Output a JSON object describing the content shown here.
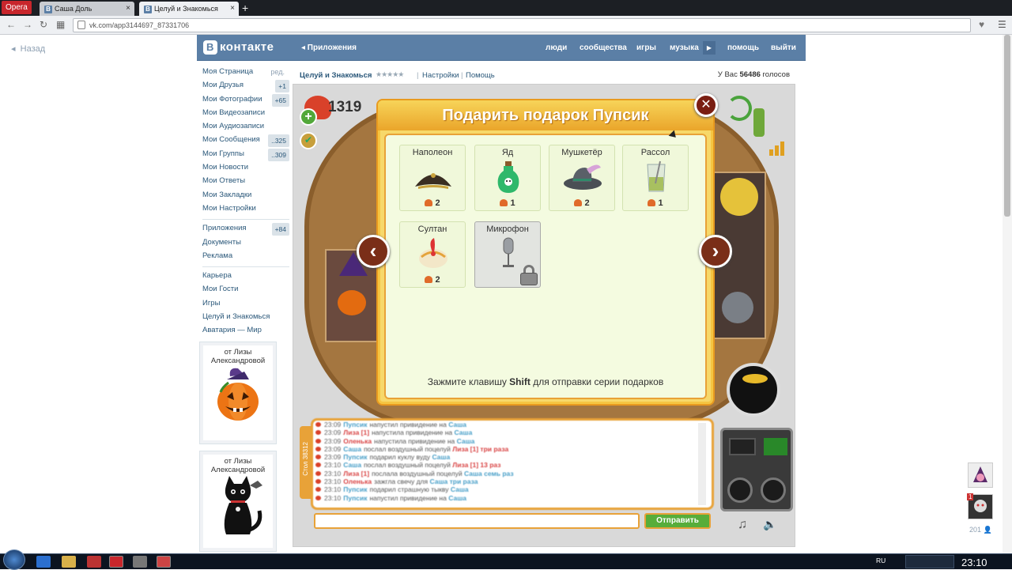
{
  "browser": {
    "menu_label": "Opera",
    "tabs": [
      {
        "label": "Саша Доль",
        "active": false
      },
      {
        "label": "Целуй и Знакомься",
        "active": true
      }
    ],
    "url": "vk.com/app3144697_87331706"
  },
  "page": {
    "back_label": "Назад"
  },
  "vk_header": {
    "logo": "контакте",
    "logo_letter": "В",
    "apps_label": "◂ Приложения",
    "nav": [
      "люди",
      "сообщества",
      "игры",
      "музыка",
      "помощь",
      "выйти"
    ]
  },
  "sidebar": {
    "items": [
      {
        "label": "Моя Страница",
        "extra": "ред."
      },
      {
        "label": "Мои Друзья",
        "badge": "+1"
      },
      {
        "label": "Мои Фотографии",
        "badge": "+65"
      },
      {
        "label": "Мои Видеозаписи"
      },
      {
        "label": "Мои Аудиозаписи"
      },
      {
        "label": "Мои Сообщения",
        "badge": "..325"
      },
      {
        "label": "Мои Группы",
        "badge": "..309"
      },
      {
        "label": "Мои Новости"
      },
      {
        "label": "Мои Ответы"
      },
      {
        "label": "Мои Закладки"
      },
      {
        "label": "Мои Настройки"
      }
    ],
    "items2": [
      {
        "label": "Приложения",
        "badge": "+84"
      },
      {
        "label": "Документы"
      },
      {
        "label": "Реклама"
      }
    ],
    "items3": [
      {
        "label": "Карьера"
      },
      {
        "label": "Мои Гости"
      },
      {
        "label": "Игры"
      },
      {
        "label": "Целуй и Знакомься"
      },
      {
        "label": "Аватария — Мир"
      }
    ],
    "gifts": [
      {
        "from": "от Лизы Александровой",
        "icon": "pumpkin-icon"
      },
      {
        "from": "от Лизы Александровой",
        "icon": "black-cat-icon"
      }
    ]
  },
  "app_header": {
    "title": "Целуй и Знакомься",
    "stars": "★★★★★",
    "settings": "Настройки",
    "help": "Помощь",
    "votes_prefix": "У Вас",
    "votes_count": "56486",
    "votes_suffix": "голосов"
  },
  "game": {
    "hearts": "1319",
    "chat_tab": "Стол 38312",
    "send_label": "Отправить",
    "chat": [
      {
        "time": "23:09",
        "name": "Пупсик",
        "text": "напустил привидение на",
        "target": "Саша"
      },
      {
        "time": "23:09",
        "name": "Лиза [1]",
        "text": "напустила привидение на",
        "target": "Саша"
      },
      {
        "time": "23:09",
        "name": "Оленька",
        "text": "напустила привидение на",
        "target": "Саша"
      },
      {
        "time": "23:09",
        "name": "Саша",
        "text": "послал воздушный поцелуй",
        "target": "Лиза [1] три раза"
      },
      {
        "time": "23:09",
        "name": "Пупсик",
        "text": "подарил куклу вуду",
        "target": "Саша"
      },
      {
        "time": "23:10",
        "name": "Саша",
        "text": "послал воздушный поцелуй",
        "target": "Лиза [1] 13 раз"
      },
      {
        "time": "23:10",
        "name": "Лиза [1]",
        "text": "послала воздушный поцелуй",
        "target": "Саша семь раз"
      },
      {
        "time": "23:10",
        "name": "Оленька",
        "text": "зажгла свечу для",
        "target": "Саша три раза"
      },
      {
        "time": "23:10",
        "name": "Пупсик",
        "text": "подарил страшную тыкву",
        "target": "Саша"
      },
      {
        "time": "23:10",
        "name": "Пупсик",
        "text": "напустил привидение на",
        "target": "Саша"
      }
    ]
  },
  "dialog": {
    "title": "Подарить подарок Пупсик",
    "hint_before": "Зажмите клавишу",
    "hint_key": "Shift",
    "hint_after": "для отправки серии подарков",
    "gifts": [
      {
        "name": "Наполеон",
        "price": "2",
        "icon": "bicorne-hat-icon",
        "locked": false
      },
      {
        "name": "Яд",
        "price": "1",
        "icon": "poison-bottle-icon",
        "locked": false
      },
      {
        "name": "Мушкетёр",
        "price": "2",
        "icon": "musketeer-hat-icon",
        "locked": false
      },
      {
        "name": "Рассол",
        "price": "1",
        "icon": "pickle-jar-icon",
        "locked": false
      },
      {
        "name": "Султан",
        "price": "2",
        "icon": "turban-icon",
        "locked": false
      },
      {
        "name": "Микрофон",
        "price": "",
        "icon": "microphone-icon",
        "locked": true
      }
    ]
  },
  "right_dock": {
    "badge": "1",
    "count": "201"
  },
  "taskbar": {
    "lang": "RU",
    "clock": "23:10"
  },
  "colors": {
    "vk_blue": "#5b7fa6",
    "link": "#2b587a",
    "dialog_orange": "#e89a1f",
    "send_green": "#57ad3a"
  }
}
